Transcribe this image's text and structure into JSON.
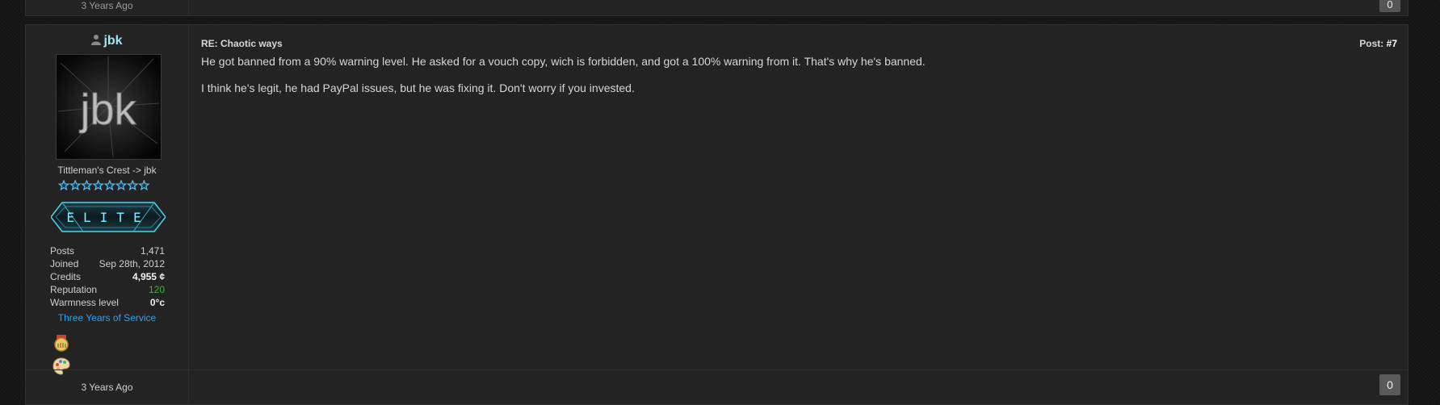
{
  "prev_post": {
    "time": "3 Years Ago",
    "likes": "0"
  },
  "post": {
    "user": {
      "name": "jbk",
      "usertitle": "Tittleman's Crest -> jbk",
      "star_count": 8,
      "userbar_text": "ELITE",
      "stats": [
        {
          "label": "Posts",
          "value": "1,471"
        },
        {
          "label": "Joined",
          "value": "Sep 28th, 2012"
        },
        {
          "label": "Credits",
          "value": "4,955 ¢"
        },
        {
          "label": "Reputation",
          "value": "120"
        },
        {
          "label": "Warmness level",
          "value": "0°c"
        }
      ],
      "award": "Three Years of Service",
      "avatar_text": "jbk"
    },
    "subject": "RE: Chaotic ways",
    "post_label": "Post:",
    "post_number": "#7",
    "body": [
      "He got banned from a 90% warning level. He asked for a vouch copy, wich is forbidden, and got a 100% warning from it. That's why he's banned.",
      "I think he's legit, he had PayPal issues, but he was fixing it. Don't worry if you invested."
    ],
    "footer": {
      "time": "3 Years Ago",
      "likes": "0"
    }
  },
  "colors": {
    "username": "#9be8ee",
    "award": "#2aa3f0",
    "reputation": "#3fb23f",
    "stars": "#5ab7e6"
  }
}
